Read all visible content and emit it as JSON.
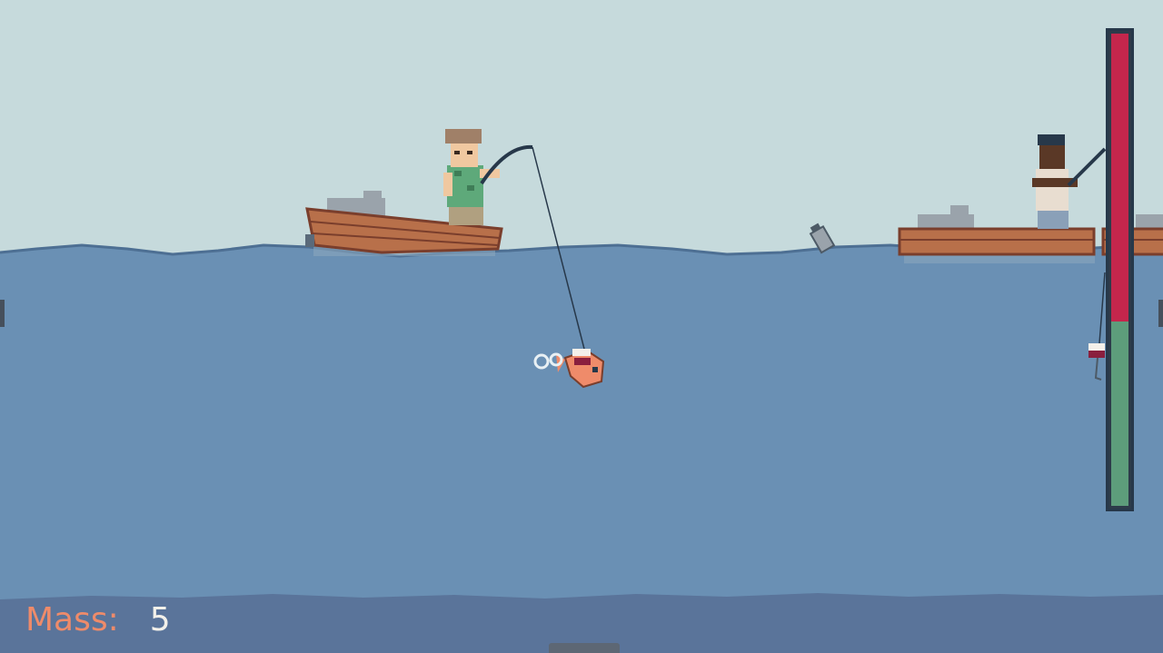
{
  "hud": {
    "mass_label": "Mass:",
    "mass_value": "5"
  },
  "meter": {
    "red_fraction": 0.61,
    "green_fraction": 0.39,
    "red_color": "#c4264c",
    "green_color": "#5d9d7b"
  },
  "palette": {
    "sky": "#c6dadc",
    "water": "#6a90b4",
    "deep_water": "#5a749a",
    "boat_wood": "#b8704a",
    "boat_plank_line": "#7a3e2c",
    "mass_label_color": "#ef8b6a"
  },
  "icons": [
    "player-fish-icon",
    "bubble-icon",
    "can-icon",
    "fishing-rod-icon",
    "lure-icon"
  ]
}
